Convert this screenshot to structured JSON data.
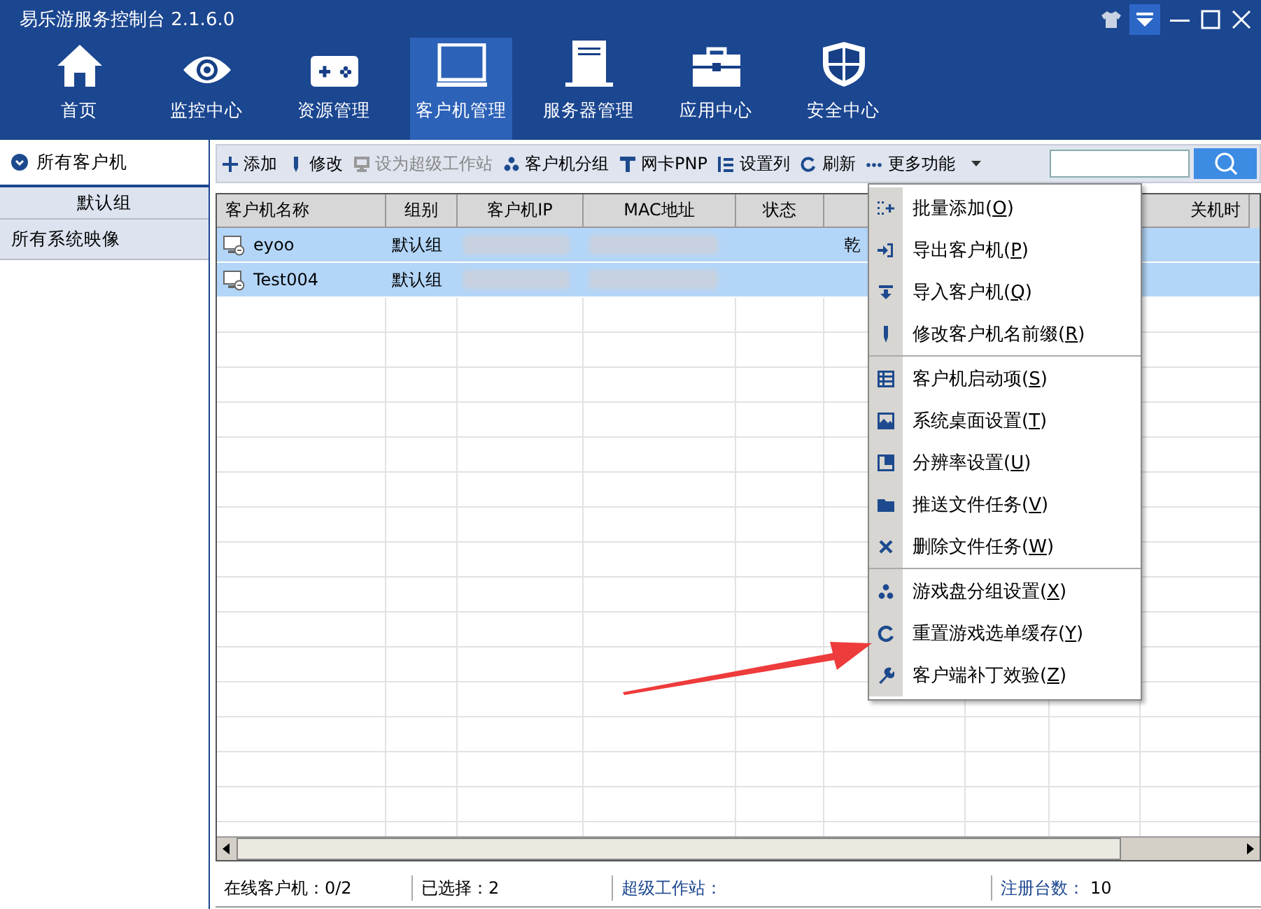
{
  "window": {
    "title": "易乐游服务控制台 2.1.6.0"
  },
  "nav": [
    {
      "label": "首页",
      "selected": false
    },
    {
      "label": "监控中心",
      "selected": false
    },
    {
      "label": "资源管理",
      "selected": false
    },
    {
      "label": "客户机管理",
      "selected": true
    },
    {
      "label": "服务器管理",
      "selected": false
    },
    {
      "label": "应用中心",
      "selected": false
    },
    {
      "label": "安全中心",
      "selected": false
    }
  ],
  "sidebar": {
    "items": [
      {
        "label": "所有客户机",
        "selected": true,
        "expanded": true,
        "children": [
          {
            "label": "默认组",
            "selected": false
          }
        ]
      },
      {
        "label": "所有系统映像",
        "selected": false
      }
    ]
  },
  "toolbar": [
    {
      "label": "添加",
      "disabled": false
    },
    {
      "label": "修改",
      "disabled": false
    },
    {
      "label": "设为超级工作站",
      "disabled": true
    },
    {
      "label": "客户机分组",
      "disabled": false
    },
    {
      "label": "网卡PNP",
      "disabled": false
    },
    {
      "label": "设置列",
      "disabled": false
    },
    {
      "label": "刷新",
      "disabled": false
    },
    {
      "label": "更多功能",
      "disabled": false
    }
  ],
  "table": {
    "columns": [
      "客户机名称",
      "组别",
      "客户机IP",
      "MAC地址",
      "状态",
      "",
      "",
      "",
      "关机时"
    ],
    "rows": [
      {
        "name": "eyoo",
        "group": "默认组",
        "column_6": "乾",
        "selected": true
      },
      {
        "name": "Test004",
        "group": "默认组",
        "column_6": "",
        "selected": true
      }
    ]
  },
  "more_menu": {
    "groups": [
      [
        "批量添加(O)",
        "导出客户机(P)",
        "导入客户机(Q)",
        "修改客户机名前缀(R)"
      ],
      [
        "客户机启动项(S)",
        "系统桌面设置(T)",
        "分辨率设置(U)",
        "推送文件任务(V)",
        "删除文件任务(W)"
      ],
      [
        "游戏盘分组设置(X)",
        "重置游戏选单缓存(Y)",
        "客户端补丁效验(Z)"
      ]
    ]
  },
  "status_bar": [
    {
      "label": "在线客户机：0/2",
      "kind": "plain"
    },
    {
      "label": "已选择：2",
      "kind": "plain"
    },
    {
      "label": "超级工作站：",
      "kind": "accent"
    },
    {
      "label": "注册台数：",
      "value": "10",
      "kind": "accent"
    }
  ]
}
